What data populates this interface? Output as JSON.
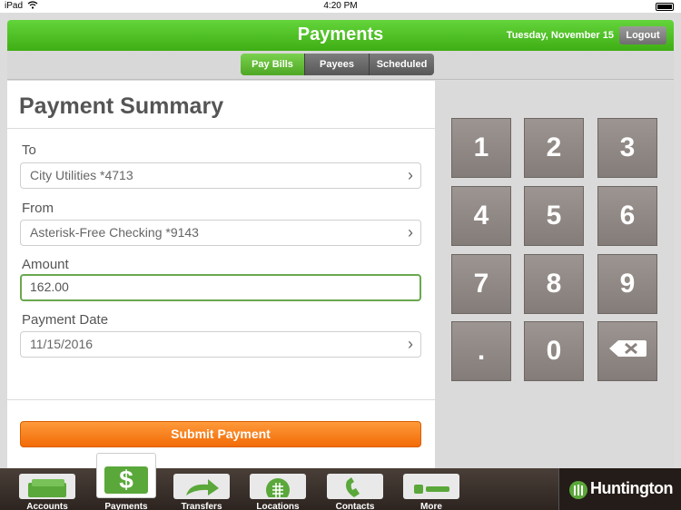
{
  "status": {
    "device": "iPad",
    "time": "4:20 PM"
  },
  "header": {
    "title": "Payments",
    "date": "Tuesday, November 15",
    "logout_label": "Logout"
  },
  "segments": [
    {
      "label": "Pay Bills",
      "active": true
    },
    {
      "label": "Payees",
      "active": false
    },
    {
      "label": "Scheduled",
      "active": false
    }
  ],
  "summary": {
    "title": "Payment Summary",
    "to_label": "To",
    "to_value": "City Utilities *4713",
    "from_label": "From",
    "from_value": "Asterisk-Free Checking *9143",
    "amount_label": "Amount",
    "amount_value": "162.00",
    "date_label": "Payment Date",
    "date_value": "11/15/2016",
    "submit_label": "Submit Payment"
  },
  "keypad": [
    "1",
    "2",
    "3",
    "4",
    "5",
    "6",
    "7",
    "8",
    "9",
    ".",
    "0",
    "backspace"
  ],
  "bottom_tabs": [
    {
      "label": "Accounts",
      "icon": "money-icon"
    },
    {
      "label": "Payments",
      "icon": "dollar-bill-icon",
      "active": true
    },
    {
      "label": "Transfers",
      "icon": "transfer-arrow-icon"
    },
    {
      "label": "Locations",
      "icon": "location-globe-icon"
    },
    {
      "label": "Contacts",
      "icon": "phone-icon"
    },
    {
      "label": "More",
      "icon": "more-icon"
    }
  ],
  "brand": {
    "name": "Huntington"
  },
  "colors": {
    "header_green": "#4cbf1f",
    "submit_orange": "#f7800f",
    "keypad_key": "#8f8783",
    "tabbar_brown": "#3a302a"
  }
}
